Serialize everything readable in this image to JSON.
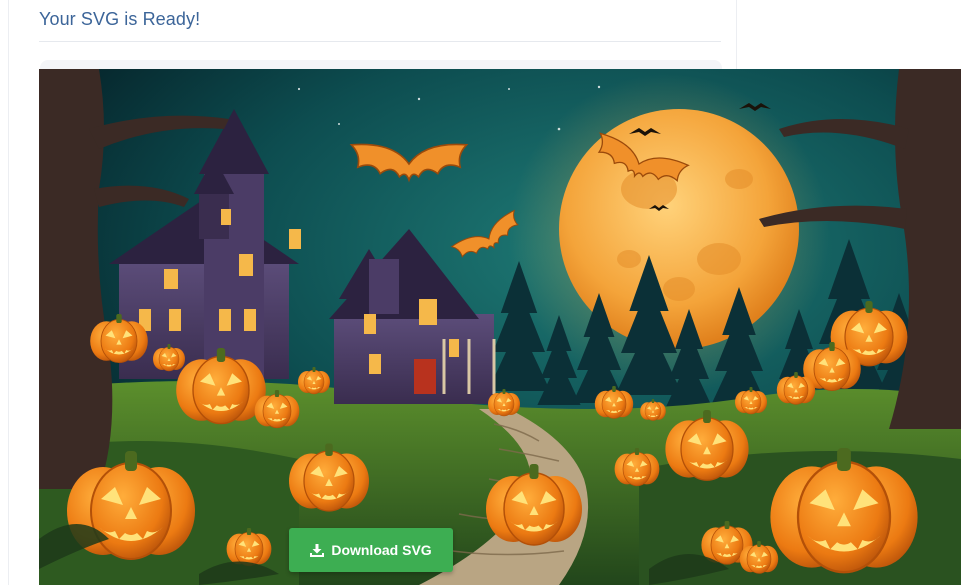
{
  "page": {
    "title": "Your SVG is Ready!"
  },
  "preview": {
    "image_name": "halloween-haunted-house-pumpkins-moon-illustration"
  },
  "actions": {
    "download_label": "Download SVG",
    "download_icon": "download-icon",
    "download_color": "#3dae52"
  },
  "colors": {
    "title": "#3c6599",
    "sky": "#0f4a4d",
    "moon": "#f2a43c",
    "pumpkin": "#f08a1e"
  }
}
